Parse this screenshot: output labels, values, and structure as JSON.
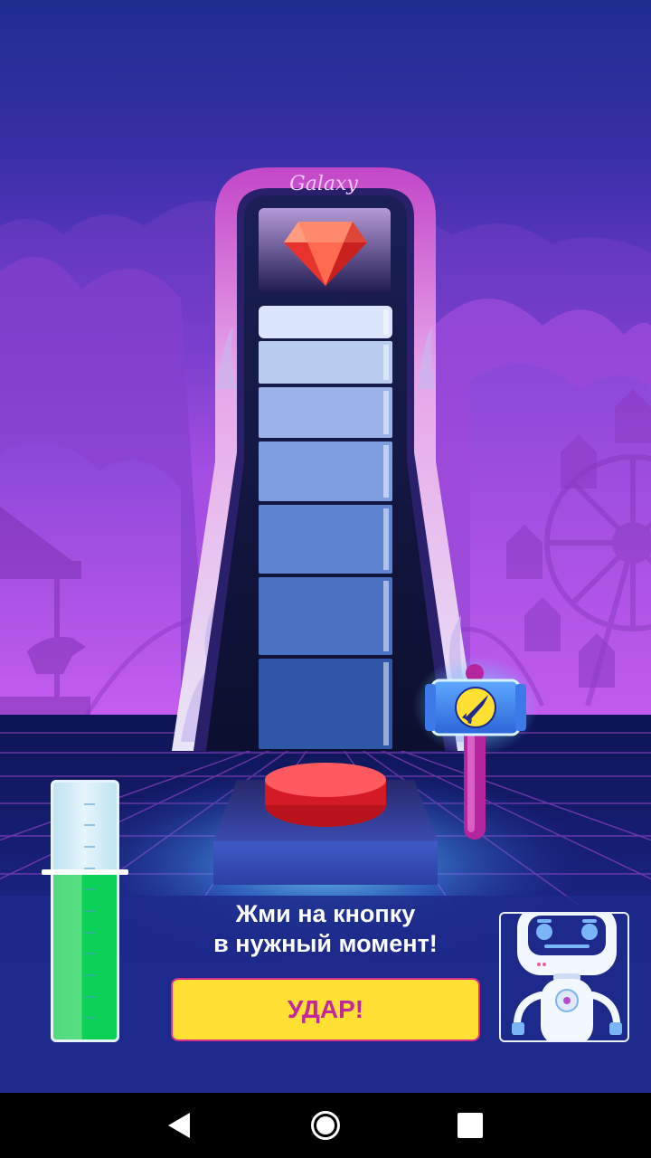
{
  "machine": {
    "sign": "Galaxy",
    "prize_icon": "ruby-gem-icon",
    "segment_count": 7
  },
  "hammer": {
    "icon": "rocket-icon"
  },
  "power_meter": {
    "level": 0.65
  },
  "message": {
    "line1": "Жми на кнопку",
    "line2": "в нужный момент!"
  },
  "hit_button": {
    "label": "УДАР!"
  },
  "robot": {
    "icon": "robot-mascot-icon"
  },
  "nav": {
    "back": "back-triangle-icon",
    "home": "home-circle-icon",
    "recent": "recent-square-icon"
  },
  "colors": {
    "sky_top": "#1f2d8f",
    "sky_mid": "#6a35c9",
    "sky_bottom": "#d65fff",
    "ground": "#1d2a8c",
    "button_yellow": "#ffe033",
    "button_text": "#c2279b",
    "meter_green": "#0bd156",
    "gem_red": "#f0473b"
  }
}
